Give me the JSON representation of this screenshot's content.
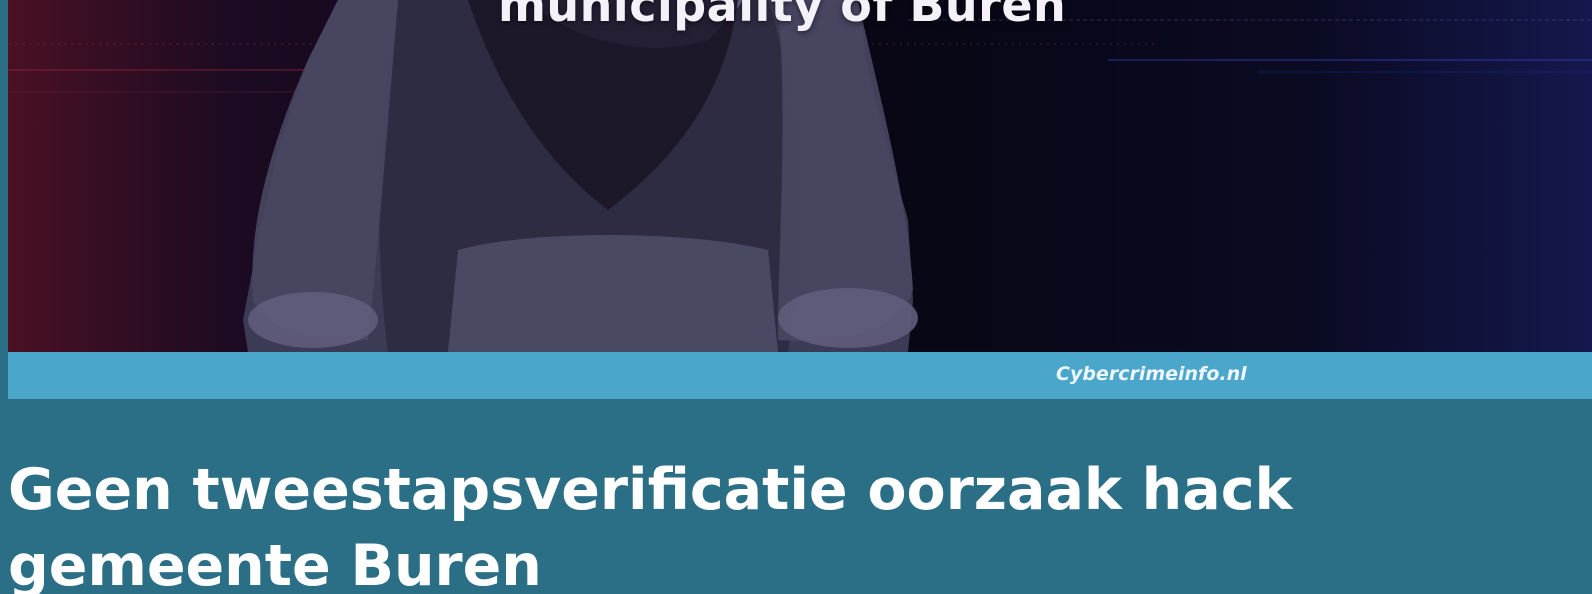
{
  "hero": {
    "headline": "municipality of Buren",
    "image_alt": "hooded figure"
  },
  "caption": {
    "source": "Cybercrimeinfo.nl"
  },
  "article": {
    "title": "Geen tweestapsverificatie oorzaak hack gemeente Buren"
  },
  "colors": {
    "page_background": "#2b6f87",
    "caption_bar": "#4aa7cb",
    "title_text": "#ffffff"
  }
}
